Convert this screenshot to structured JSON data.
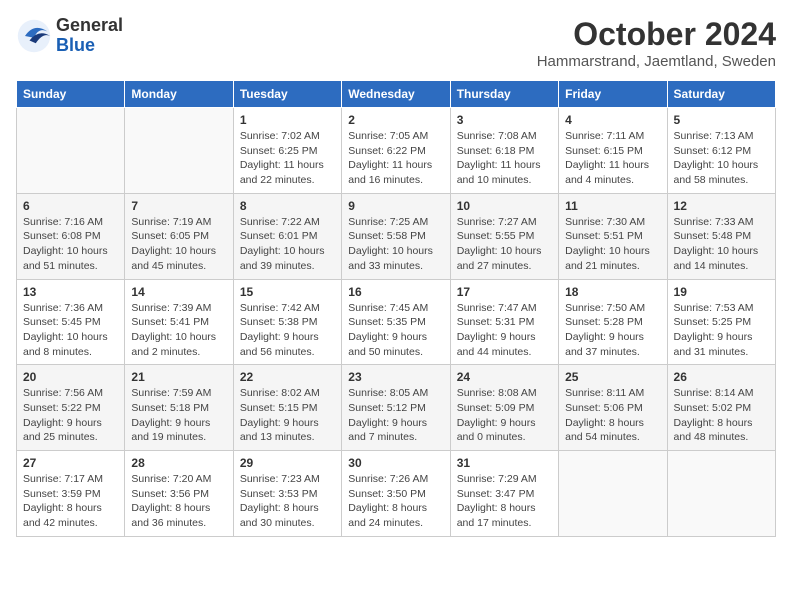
{
  "header": {
    "logo_line1": "General",
    "logo_line2": "Blue",
    "title": "October 2024",
    "subtitle": "Hammarstrand, Jaemtland, Sweden"
  },
  "weekdays": [
    "Sunday",
    "Monday",
    "Tuesday",
    "Wednesday",
    "Thursday",
    "Friday",
    "Saturday"
  ],
  "weeks": [
    [
      {
        "day": null
      },
      {
        "day": null
      },
      {
        "day": "1",
        "sunrise": "Sunrise: 7:02 AM",
        "sunset": "Sunset: 6:25 PM",
        "daylight": "Daylight: 11 hours and 22 minutes."
      },
      {
        "day": "2",
        "sunrise": "Sunrise: 7:05 AM",
        "sunset": "Sunset: 6:22 PM",
        "daylight": "Daylight: 11 hours and 16 minutes."
      },
      {
        "day": "3",
        "sunrise": "Sunrise: 7:08 AM",
        "sunset": "Sunset: 6:18 PM",
        "daylight": "Daylight: 11 hours and 10 minutes."
      },
      {
        "day": "4",
        "sunrise": "Sunrise: 7:11 AM",
        "sunset": "Sunset: 6:15 PM",
        "daylight": "Daylight: 11 hours and 4 minutes."
      },
      {
        "day": "5",
        "sunrise": "Sunrise: 7:13 AM",
        "sunset": "Sunset: 6:12 PM",
        "daylight": "Daylight: 10 hours and 58 minutes."
      }
    ],
    [
      {
        "day": "6",
        "sunrise": "Sunrise: 7:16 AM",
        "sunset": "Sunset: 6:08 PM",
        "daylight": "Daylight: 10 hours and 51 minutes."
      },
      {
        "day": "7",
        "sunrise": "Sunrise: 7:19 AM",
        "sunset": "Sunset: 6:05 PM",
        "daylight": "Daylight: 10 hours and 45 minutes."
      },
      {
        "day": "8",
        "sunrise": "Sunrise: 7:22 AM",
        "sunset": "Sunset: 6:01 PM",
        "daylight": "Daylight: 10 hours and 39 minutes."
      },
      {
        "day": "9",
        "sunrise": "Sunrise: 7:25 AM",
        "sunset": "Sunset: 5:58 PM",
        "daylight": "Daylight: 10 hours and 33 minutes."
      },
      {
        "day": "10",
        "sunrise": "Sunrise: 7:27 AM",
        "sunset": "Sunset: 5:55 PM",
        "daylight": "Daylight: 10 hours and 27 minutes."
      },
      {
        "day": "11",
        "sunrise": "Sunrise: 7:30 AM",
        "sunset": "Sunset: 5:51 PM",
        "daylight": "Daylight: 10 hours and 21 minutes."
      },
      {
        "day": "12",
        "sunrise": "Sunrise: 7:33 AM",
        "sunset": "Sunset: 5:48 PM",
        "daylight": "Daylight: 10 hours and 14 minutes."
      }
    ],
    [
      {
        "day": "13",
        "sunrise": "Sunrise: 7:36 AM",
        "sunset": "Sunset: 5:45 PM",
        "daylight": "Daylight: 10 hours and 8 minutes."
      },
      {
        "day": "14",
        "sunrise": "Sunrise: 7:39 AM",
        "sunset": "Sunset: 5:41 PM",
        "daylight": "Daylight: 10 hours and 2 minutes."
      },
      {
        "day": "15",
        "sunrise": "Sunrise: 7:42 AM",
        "sunset": "Sunset: 5:38 PM",
        "daylight": "Daylight: 9 hours and 56 minutes."
      },
      {
        "day": "16",
        "sunrise": "Sunrise: 7:45 AM",
        "sunset": "Sunset: 5:35 PM",
        "daylight": "Daylight: 9 hours and 50 minutes."
      },
      {
        "day": "17",
        "sunrise": "Sunrise: 7:47 AM",
        "sunset": "Sunset: 5:31 PM",
        "daylight": "Daylight: 9 hours and 44 minutes."
      },
      {
        "day": "18",
        "sunrise": "Sunrise: 7:50 AM",
        "sunset": "Sunset: 5:28 PM",
        "daylight": "Daylight: 9 hours and 37 minutes."
      },
      {
        "day": "19",
        "sunrise": "Sunrise: 7:53 AM",
        "sunset": "Sunset: 5:25 PM",
        "daylight": "Daylight: 9 hours and 31 minutes."
      }
    ],
    [
      {
        "day": "20",
        "sunrise": "Sunrise: 7:56 AM",
        "sunset": "Sunset: 5:22 PM",
        "daylight": "Daylight: 9 hours and 25 minutes."
      },
      {
        "day": "21",
        "sunrise": "Sunrise: 7:59 AM",
        "sunset": "Sunset: 5:18 PM",
        "daylight": "Daylight: 9 hours and 19 minutes."
      },
      {
        "day": "22",
        "sunrise": "Sunrise: 8:02 AM",
        "sunset": "Sunset: 5:15 PM",
        "daylight": "Daylight: 9 hours and 13 minutes."
      },
      {
        "day": "23",
        "sunrise": "Sunrise: 8:05 AM",
        "sunset": "Sunset: 5:12 PM",
        "daylight": "Daylight: 9 hours and 7 minutes."
      },
      {
        "day": "24",
        "sunrise": "Sunrise: 8:08 AM",
        "sunset": "Sunset: 5:09 PM",
        "daylight": "Daylight: 9 hours and 0 minutes."
      },
      {
        "day": "25",
        "sunrise": "Sunrise: 8:11 AM",
        "sunset": "Sunset: 5:06 PM",
        "daylight": "Daylight: 8 hours and 54 minutes."
      },
      {
        "day": "26",
        "sunrise": "Sunrise: 8:14 AM",
        "sunset": "Sunset: 5:02 PM",
        "daylight": "Daylight: 8 hours and 48 minutes."
      }
    ],
    [
      {
        "day": "27",
        "sunrise": "Sunrise: 7:17 AM",
        "sunset": "Sunset: 3:59 PM",
        "daylight": "Daylight: 8 hours and 42 minutes."
      },
      {
        "day": "28",
        "sunrise": "Sunrise: 7:20 AM",
        "sunset": "Sunset: 3:56 PM",
        "daylight": "Daylight: 8 hours and 36 minutes."
      },
      {
        "day": "29",
        "sunrise": "Sunrise: 7:23 AM",
        "sunset": "Sunset: 3:53 PM",
        "daylight": "Daylight: 8 hours and 30 minutes."
      },
      {
        "day": "30",
        "sunrise": "Sunrise: 7:26 AM",
        "sunset": "Sunset: 3:50 PM",
        "daylight": "Daylight: 8 hours and 24 minutes."
      },
      {
        "day": "31",
        "sunrise": "Sunrise: 7:29 AM",
        "sunset": "Sunset: 3:47 PM",
        "daylight": "Daylight: 8 hours and 17 minutes."
      },
      {
        "day": null
      },
      {
        "day": null
      }
    ]
  ]
}
